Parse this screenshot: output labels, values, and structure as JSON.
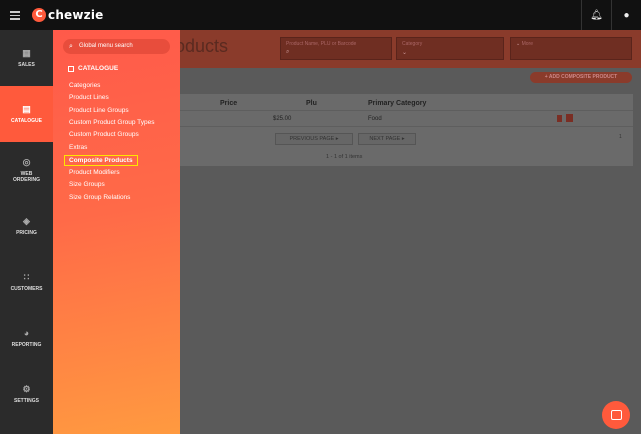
{
  "app": {
    "logo_text": "chewzie"
  },
  "sidebar": {
    "items": [
      {
        "label": "SALES",
        "icon": "sales-icon"
      },
      {
        "label": "CATALOGUE",
        "icon": "catalogue-icon",
        "active": true
      },
      {
        "label": "WEB ORDERING",
        "icon": "web-icon"
      },
      {
        "label": "PRICING",
        "icon": "pricing-icon"
      },
      {
        "label": "CUSTOMERS",
        "icon": "customers-icon"
      },
      {
        "label": "REPORTING",
        "icon": "reporting-icon"
      },
      {
        "label": "SETTINGS",
        "icon": "settings-icon"
      }
    ]
  },
  "header": {
    "title": "oducts",
    "search_placeholder": "Product Name, PLU or Barcode",
    "category_label": "Category",
    "more_label": "More"
  },
  "actions": {
    "add_composite": "+ ADD COMPOSITE PRODUCT"
  },
  "table": {
    "columns": [
      "Price",
      "Plu",
      "Primary Category"
    ],
    "rows": [
      {
        "price": "$25.00",
        "plu": "",
        "category": "Food"
      }
    ],
    "prev_label": "PREVIOUS PAGE",
    "next_label": "NEXT PAGE",
    "page_num": "1",
    "summary": "1 - 1 of 1 items"
  },
  "menu": {
    "search_placeholder": "Global menu search",
    "heading": "CATALOGUE",
    "items": [
      "Categories",
      "Product Lines",
      "Product Line Groups",
      "Custom Product Group Types",
      "Custom Product Groups",
      "Extras",
      "Composite Products",
      "Product Modifiers",
      "Size Groups",
      "Size Group Relations"
    ],
    "selected_index": 6
  },
  "colors": {
    "accent": "#ff5a3c",
    "highlight": "#ffe600",
    "topbar": "#111111",
    "sidebar": "#2b2b2b"
  }
}
